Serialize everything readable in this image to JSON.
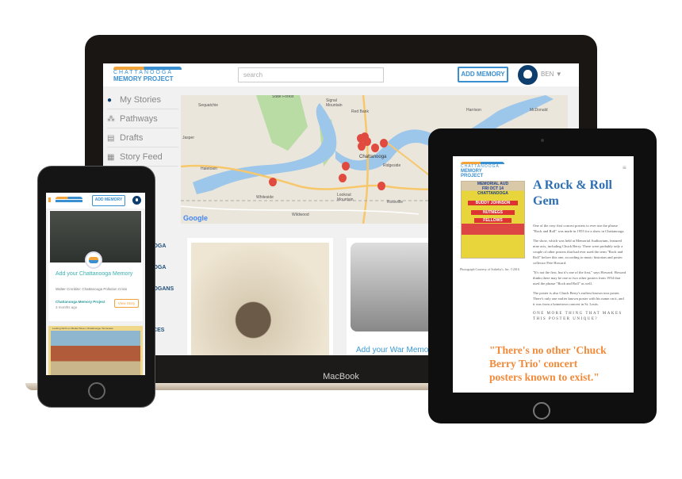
{
  "laptop": {
    "brand_label": "MacBook",
    "logo": {
      "line1": "CHATTANOOGA",
      "line2": "MEMORY PROJECT"
    },
    "search_placeholder": "search",
    "add_memory_label": "ADD MEMORY",
    "user_name": "BEN",
    "user_menu_caret": "▼",
    "sidebar": [
      {
        "label": "My Stories",
        "icon": "user-icon"
      },
      {
        "label": "Pathways",
        "icon": "pathways-icon"
      },
      {
        "label": "Drafts",
        "icon": "document-icon"
      },
      {
        "label": "Story Feed",
        "icon": "feed-icon"
      }
    ],
    "sidebar_fragments": [
      "OOGA",
      "O",
      "OOGA",
      "OOGANS",
      "N",
      "ACES"
    ],
    "map": {
      "places": [
        "Sequatchie",
        "Signal Mountain",
        "Red Bank",
        "Harrison",
        "McDonald",
        "Jasper",
        "Chattanooga",
        "Ridgeside",
        "Haletown",
        "Whiteside",
        "Lookout Mountain",
        "East Ridge",
        "Rossville",
        "Wildwood",
        "State Forest"
      ],
      "attribution": "Google",
      "marker_color": "#e04a3f"
    },
    "cards": [
      {
        "title": ""
      },
      {
        "title": "Add your War Memory"
      }
    ]
  },
  "tablet": {
    "logo": {
      "line1": "CHATTANOOGA",
      "line2": "MEMORY PROJECT"
    },
    "menu_icon": "hamburger-icon",
    "title": "A Rock & Roll Gem",
    "poster_lines": [
      "MEMORIAL AUD",
      "FRI OCT 14",
      "CHATTANOOGA",
      "BUDDY JOHNSON",
      "NUTMEGS",
      "FELLOWS"
    ],
    "caption": "Photograph Courtesy of Sotheby's, Inc. ©2016",
    "paragraphs": [
      "One of the very first concert posters to ever use the phrase \"Rock and Roll\" was made in 1955 for a show in Chattanooga.",
      "The show, which was held at Memorial Auditorium, featured nine acts, including Chuck Berry. There were probably only a couple of other posters that had ever used the term \"Rock and Roll\" before this one, according to music historian and poster collector Pete Howard.",
      "\"It's not the first, but it's one of the first,\" says Howard. Howard thinks there may be one or two other posters from 1954 that used the phrase \"Rock and Roll\" as well.",
      "The poster is also Chuck Berry's earliest known tour poster. There's only one earlier known poster with his name on it, and it was from a hometown concert in St. Louis."
    ],
    "subheading": "ONE MORE THING THAT MAKES THIS POSTER UNIQUE?",
    "quote": "\"There's no other 'Chuck Berry Trio' concert posters known to exist.\"",
    "title_color": "#2e6fb3",
    "quote_color": "#f28a3a"
  },
  "phone": {
    "add_memory_label": "ADD MEMORY",
    "card": {
      "title": "Add your Chattanooga Memory",
      "subtitle": "Walter Cronkite: Chattanooga Pollution Crisis",
      "author": "Chattanooga Memory Project",
      "time": "3 months ago",
      "button": "View Story"
    },
    "postcard_caption": "Looking North on Market Street, Chattanooga, Tennessee"
  }
}
